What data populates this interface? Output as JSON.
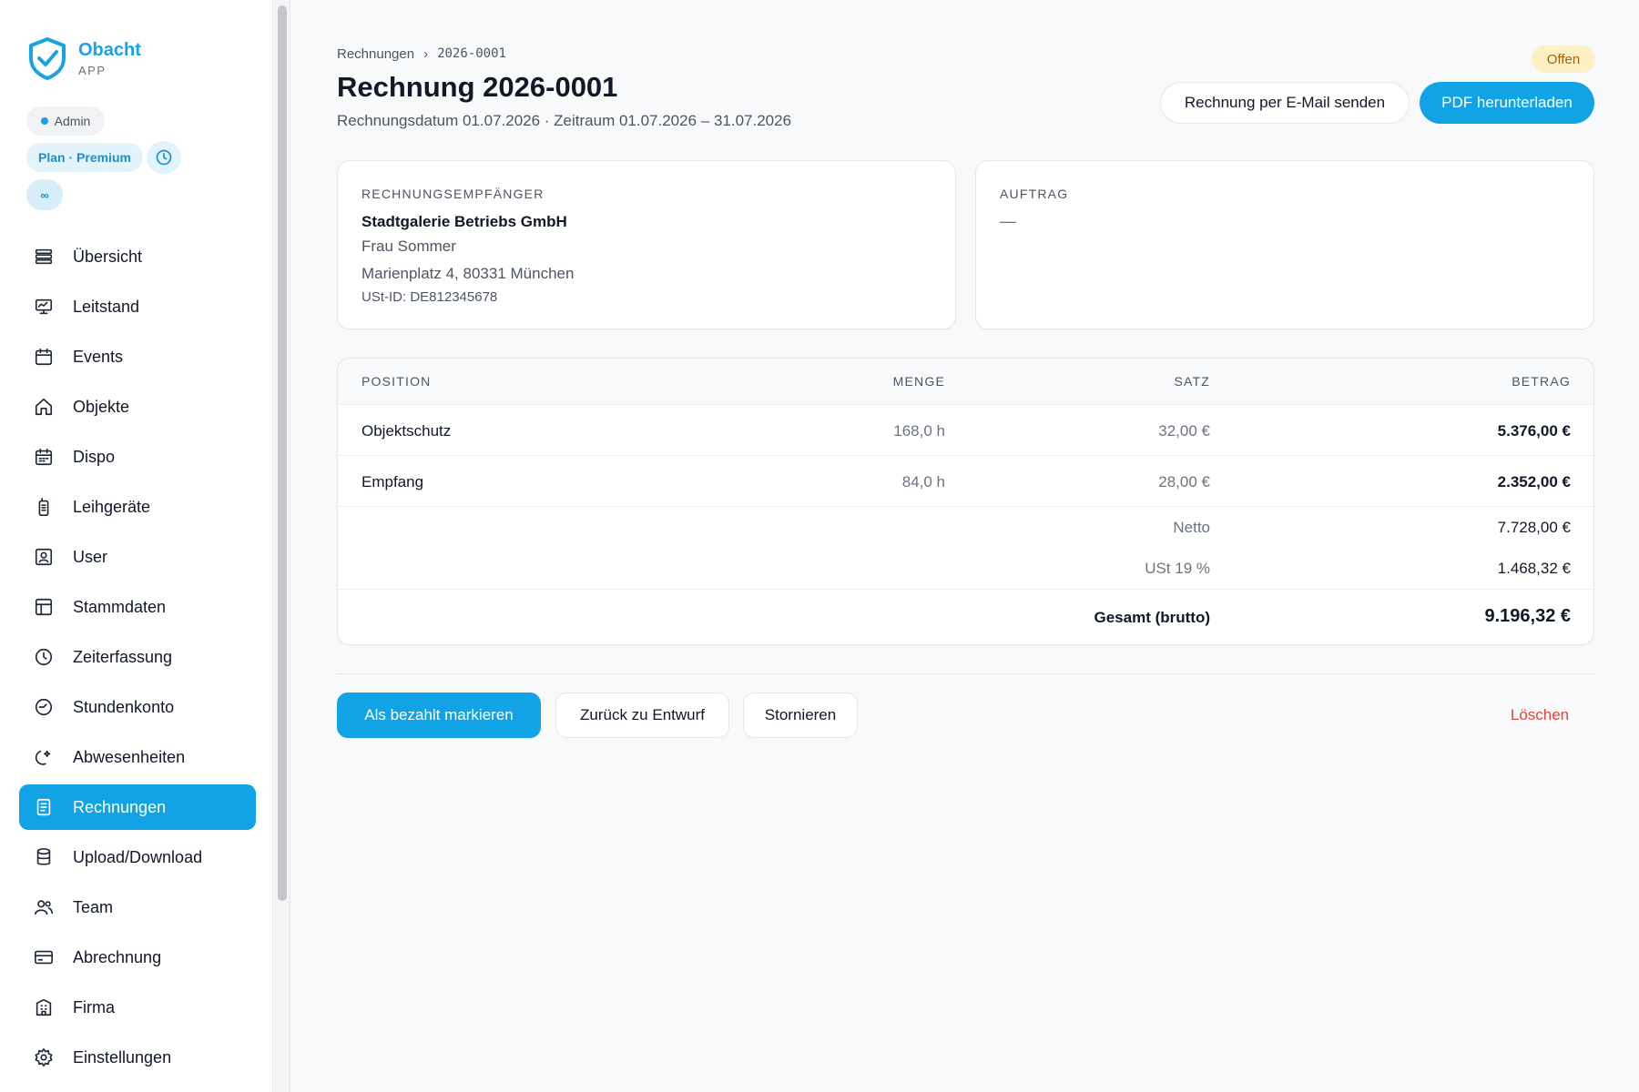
{
  "brand": {
    "name": "Obacht",
    "sub": "APP"
  },
  "role_badge": "Admin",
  "plan_badge": "Plan · Premium",
  "infinity_badge": "∞",
  "sidebar": {
    "items": [
      {
        "label": "Übersicht",
        "icon": "stack-icon"
      },
      {
        "label": "Leitstand",
        "icon": "monitor-icon"
      },
      {
        "label": "Events",
        "icon": "calendar-icon"
      },
      {
        "label": "Objekte",
        "icon": "home-icon"
      },
      {
        "label": "Dispo",
        "icon": "calendar-grid-icon"
      },
      {
        "label": "Leihgeräte",
        "icon": "radio-device-icon"
      },
      {
        "label": "User",
        "icon": "user-badge-icon"
      },
      {
        "label": "Stammdaten",
        "icon": "layout-icon"
      },
      {
        "label": "Zeiterfassung",
        "icon": "clock-icon"
      },
      {
        "label": "Stundenkonto",
        "icon": "clock-history-icon"
      },
      {
        "label": "Abwesenheiten",
        "icon": "moon-star-icon"
      },
      {
        "label": "Rechnungen",
        "icon": "document-icon",
        "active": true
      },
      {
        "label": "Upload/Download",
        "icon": "database-icon"
      },
      {
        "label": "Team",
        "icon": "team-icon"
      },
      {
        "label": "Abrechnung",
        "icon": "credit-card-icon"
      },
      {
        "label": "Firma",
        "icon": "building-icon"
      },
      {
        "label": "Einstellungen",
        "icon": "gear-icon"
      }
    ]
  },
  "breadcrumb": {
    "parent": "Rechnungen",
    "separator": "›",
    "current": "2026-0001"
  },
  "header": {
    "title": "Rechnung 2026-0001",
    "subtitle": "Rechnungsdatum 01.07.2026 · Zeitraum 01.07.2026 – 31.07.2026",
    "status": "Offen",
    "email_button": "Rechnung per E-Mail senden",
    "pdf_button": "PDF herunterladen"
  },
  "recipient": {
    "label": "RECHNUNGSEMPFÄNGER",
    "company": "Stadtgalerie Betriebs GmbH",
    "contact": "Frau Sommer",
    "address": "Marienplatz 4, 80331 München",
    "vat_id": "USt-ID: DE812345678"
  },
  "auftrag": {
    "label": "AUFTRAG",
    "value": "—"
  },
  "table": {
    "headers": {
      "position": "POSITION",
      "menge": "MENGE",
      "satz": "SATZ",
      "betrag": "BETRAG"
    },
    "rows": [
      {
        "position": "Objektschutz",
        "menge": "168,0 h",
        "satz": "32,00 €",
        "betrag": "5.376,00 €"
      },
      {
        "position": "Empfang",
        "menge": "84,0 h",
        "satz": "28,00 €",
        "betrag": "2.352,00 €"
      }
    ],
    "netto_label": "Netto",
    "netto_value": "7.728,00 €",
    "ust_label": "USt 19 %",
    "ust_value": "1.468,32 €",
    "total_label": "Gesamt (brutto)",
    "total_value": "9.196,32 €"
  },
  "actions": {
    "mark_paid": "Als bezahlt markieren",
    "back_to_draft": "Zurück zu Entwurf",
    "cancel": "Stornieren",
    "delete": "Löschen"
  },
  "colors": {
    "accent": "#11a3e6",
    "status_bg": "#fdf0c4",
    "status_text": "#a16207",
    "danger": "#e0453b"
  }
}
